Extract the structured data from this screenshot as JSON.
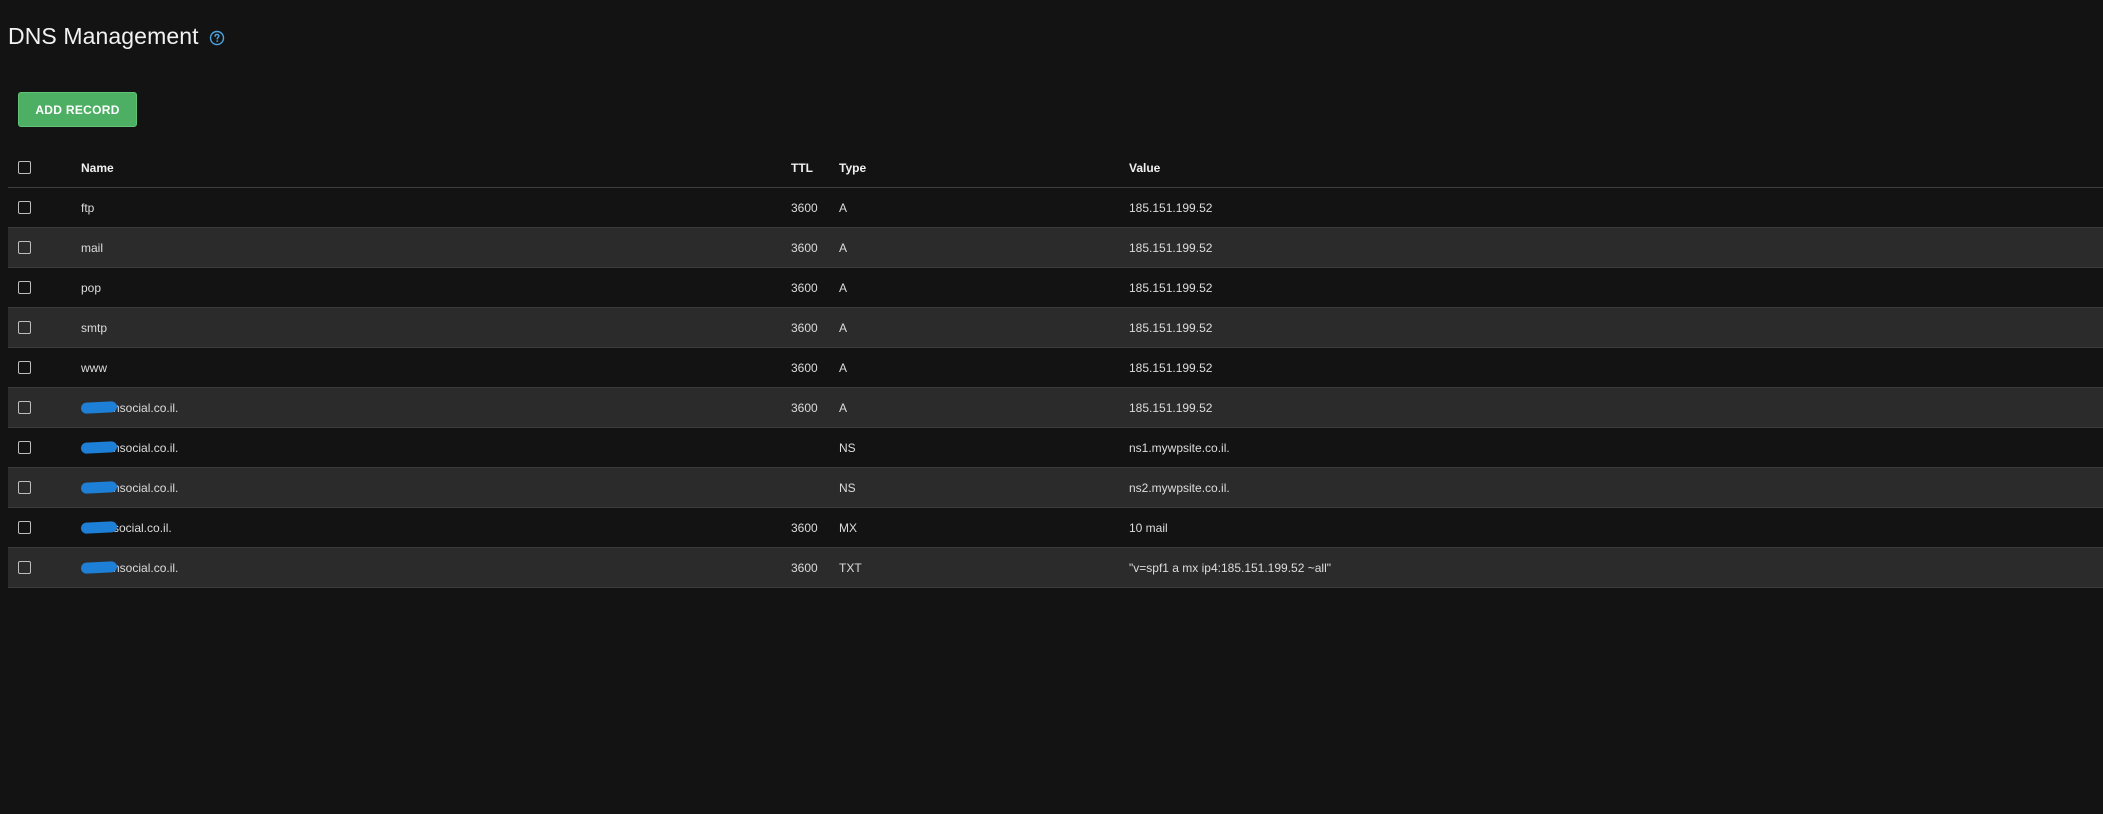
{
  "page": {
    "title": "DNS Management",
    "help_icon": "question-circle-icon"
  },
  "toolbar": {
    "add_record_label": "ADD RECORD"
  },
  "table": {
    "columns": {
      "name": "Name",
      "ttl": "TTL",
      "type": "Type",
      "value": "Value"
    },
    "rows": [
      {
        "name": "ftp",
        "ttl": "3600",
        "type": "A",
        "value": "185.151.199.52"
      },
      {
        "name": "mail",
        "ttl": "3600",
        "type": "A",
        "value": "185.151.199.52"
      },
      {
        "name": "pop",
        "ttl": "3600",
        "type": "A",
        "value": "185.151.199.52"
      },
      {
        "name": "smtp",
        "ttl": "3600",
        "type": "A",
        "value": "185.151.199.52"
      },
      {
        "name": "www",
        "ttl": "3600",
        "type": "A",
        "value": "185.151.199.52"
      },
      {
        "name": "nsocial.co.il.",
        "ttl": "3600",
        "type": "A",
        "value": "185.151.199.52"
      },
      {
        "name": "nsocial.co.il.",
        "ttl": "",
        "type": "NS",
        "value": "ns1.mywpsite.co.il."
      },
      {
        "name": "nsocial.co.il.",
        "ttl": "",
        "type": "NS",
        "value": "ns2.mywpsite.co.il."
      },
      {
        "name": "social.co.il.",
        "ttl": "3600",
        "type": "MX",
        "value": "10 mail"
      },
      {
        "name": "nsocial.co.il.",
        "ttl": "3600",
        "type": "TXT",
        "value": "\"v=spf1 a mx ip4:185.151.199.52 ~all\""
      }
    ]
  },
  "colors": {
    "background": "#131313",
    "row_alt": "#2b2b2b",
    "accent_button": "#4caf63",
    "help_icon": "#4aa3df",
    "redaction": "#1d7fd6"
  }
}
